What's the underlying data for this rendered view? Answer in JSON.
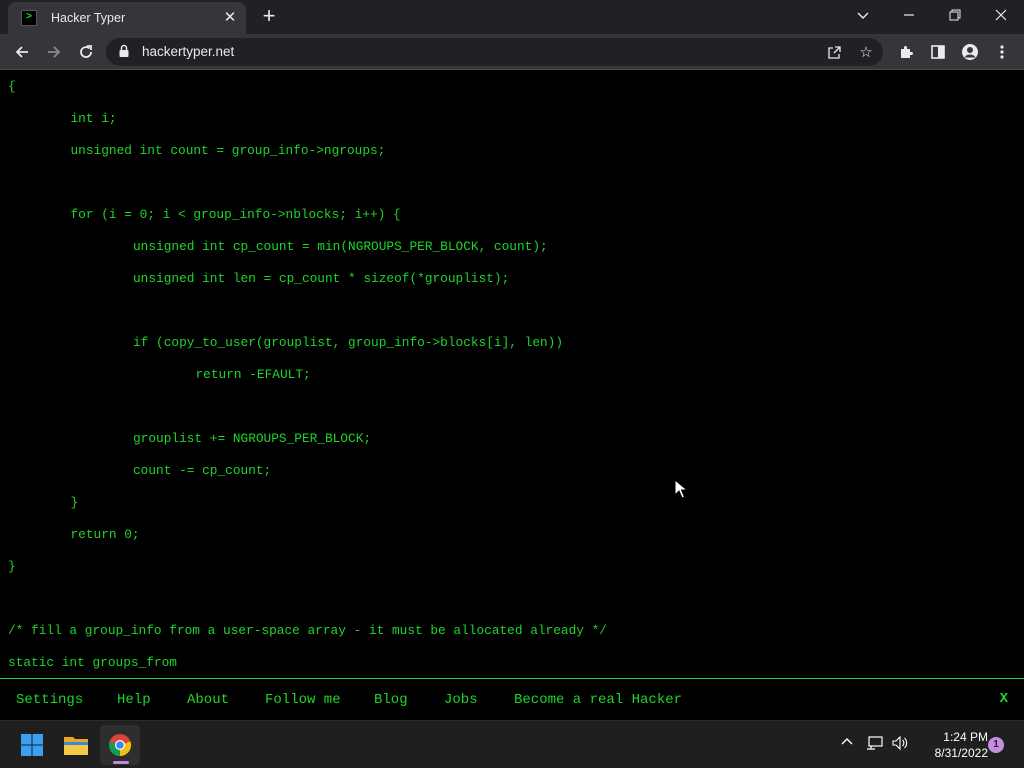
{
  "browser": {
    "tab": {
      "title": "Hacker Typer",
      "favicon_text": ">"
    },
    "url": "hackertyper.net"
  },
  "code": {
    "color": "#1fd52a",
    "lines": [
      {
        "text": "{",
        "row": 0,
        "indent": 0
      },
      {
        "text": "int i;",
        "row": 2,
        "indent": 1
      },
      {
        "text": "unsigned int count = group_info->ngroups;",
        "row": 4,
        "indent": 1
      },
      {
        "text": "for (i = 0; i < group_info->nblocks; i++) {",
        "row": 8,
        "indent": 1
      },
      {
        "text": "unsigned int cp_count = min(NGROUPS_PER_BLOCK, count);",
        "row": 10,
        "indent": 2
      },
      {
        "text": "unsigned int len = cp_count * sizeof(*grouplist);",
        "row": 12,
        "indent": 2
      },
      {
        "text": "if (copy_to_user(grouplist, group_info->blocks[i], len))",
        "row": 16,
        "indent": 2
      },
      {
        "text": "return -EFAULT;",
        "row": 18,
        "indent": 3
      },
      {
        "text": "grouplist += NGROUPS_PER_BLOCK;",
        "row": 22,
        "indent": 2
      },
      {
        "text": "count -= cp_count;",
        "row": 24,
        "indent": 2
      },
      {
        "text": "}",
        "row": 26,
        "indent": 1
      },
      {
        "text": "return 0;",
        "row": 28,
        "indent": 1
      },
      {
        "text": "}",
        "row": 30,
        "indent": 0
      },
      {
        "text": "/* fill a group_info from a user-space array - it must be allocated already */",
        "row": 34,
        "indent": 0
      },
      {
        "text": "static int groups_from",
        "row": 36,
        "indent": 0
      }
    ]
  },
  "menu": {
    "items": [
      "Settings",
      "Help",
      "About",
      "Follow me",
      "Blog",
      "Jobs",
      "Become a real Hacker"
    ],
    "close_label": "X"
  },
  "taskbar": {
    "time": "1:24 PM",
    "date": "8/31/2022",
    "notification_count": "1"
  }
}
